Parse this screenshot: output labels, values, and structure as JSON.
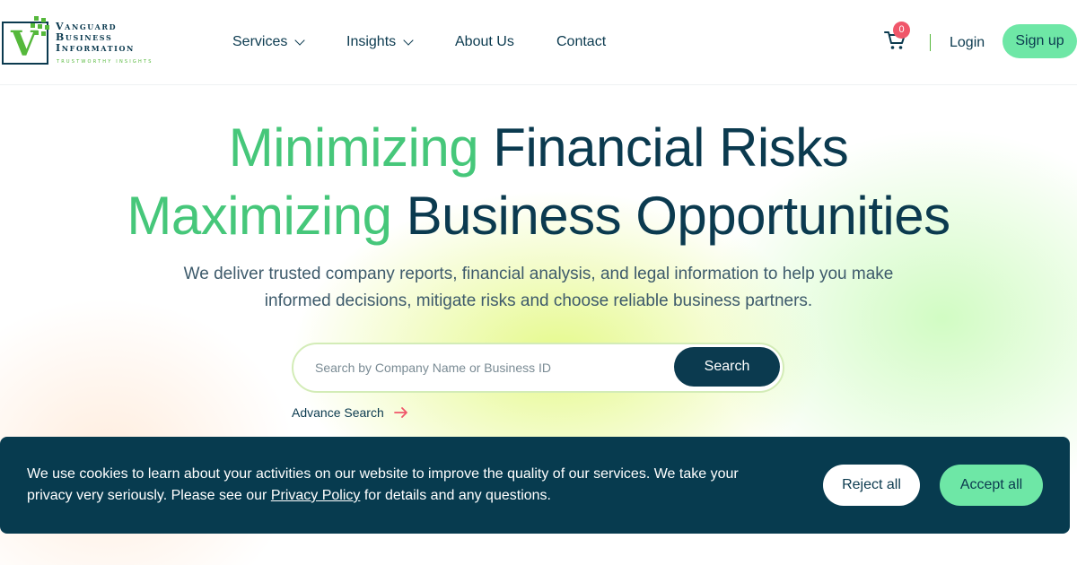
{
  "brand": {
    "name_line1": "Vanguard",
    "name_line2": "Business",
    "name_line3": "Information",
    "tagline": "TRUSTWORTHY INSIGHTS",
    "logo_letter": "V",
    "colors": {
      "primary": "#0b3a4f",
      "accent": "#46c77a",
      "mint": "#6ee7a6",
      "badge": "#f0566a"
    }
  },
  "nav": {
    "items": [
      {
        "label": "Services",
        "has_dropdown": true
      },
      {
        "label": "Insights",
        "has_dropdown": true
      },
      {
        "label": "About Us",
        "has_dropdown": false
      },
      {
        "label": "Contact",
        "has_dropdown": false
      }
    ],
    "cart_icon": "cart-icon",
    "cart_count": "0",
    "login_label": "Login",
    "signup_label": "Sign up"
  },
  "hero": {
    "line1_highlight": "Minimizing",
    "line1_rest": "Financial Risks",
    "line2_highlight": "Maximizing",
    "line2_rest": "Business Opportunities",
    "subtitle": "We deliver trusted company reports, financial analysis, and legal information to help you make informed decisions, mitigate risks and choose reliable business partners.",
    "search_placeholder": "Search by Company Name or Business ID",
    "search_value": "",
    "search_button": "Search",
    "advance_label": "Advance Search",
    "advance_icon": "arrow-right-icon"
  },
  "cookie": {
    "text_before": "We use cookies to learn about your activities on our website to improve the quality of our services. We take your privacy very seriously. Please see our",
    "link_label": "Privacy Policy",
    "text_after": "for details and any questions.",
    "reject_label": "Reject all",
    "accept_label": "Accept all"
  }
}
